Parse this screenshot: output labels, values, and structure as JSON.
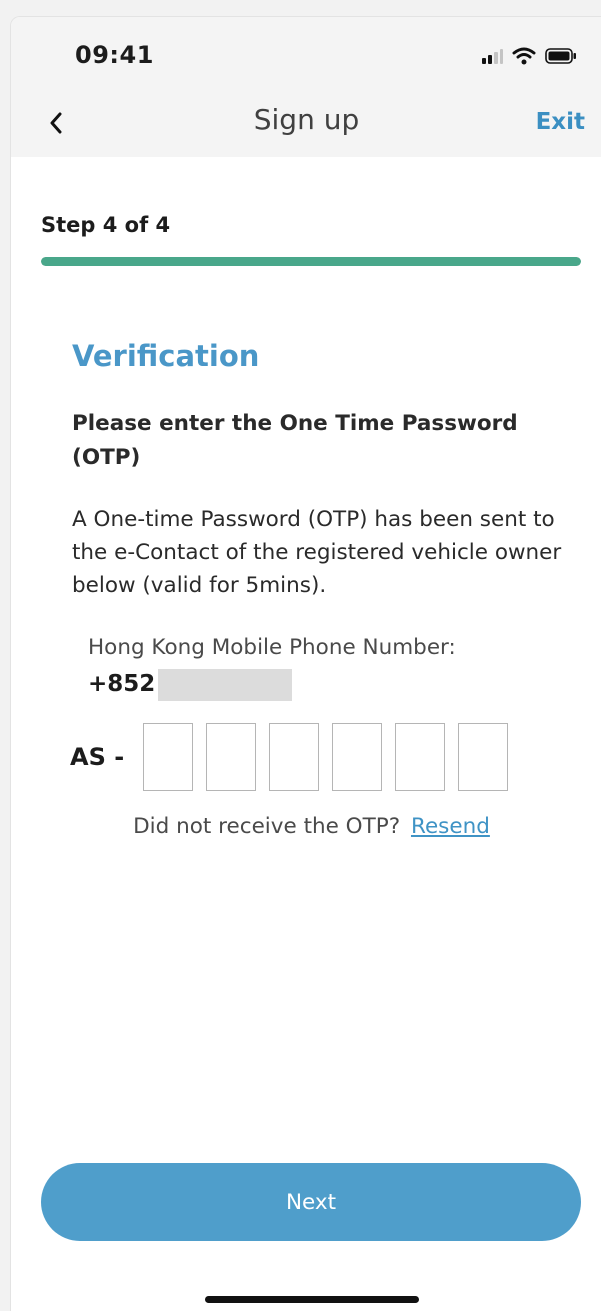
{
  "status_bar": {
    "time": "09:41",
    "icons": [
      "signal-icon",
      "wifi-icon",
      "battery-icon"
    ]
  },
  "nav": {
    "back_icon": "chevron-left-icon",
    "title": "Sign up",
    "exit_label": "Exit"
  },
  "progress": {
    "label": "Step 4 of 4",
    "current": 4,
    "total": 4,
    "fill_fraction": 1.0
  },
  "verification": {
    "title": "Verification",
    "lead": "Please enter the One Time Password (OTP)",
    "description": "A One-time Password (OTP) has been sent to the e-Contact of the registered vehicle owner below (valid for 5mins).",
    "phone_label": "Hong Kong Mobile Phone Number:",
    "phone_prefix": "+852",
    "otp_prefix": "AS -",
    "otp_length": 6,
    "otp_values": [
      "",
      "",
      "",
      "",
      "",
      ""
    ],
    "resend_prompt": "Did not receive the OTP?",
    "resend_label": "Resend"
  },
  "footer": {
    "next_label": "Next"
  },
  "colors": {
    "accent": "#4a97c8",
    "link": "#3f93c5",
    "progress": "#49a78a",
    "button": "#4f9ecb"
  }
}
